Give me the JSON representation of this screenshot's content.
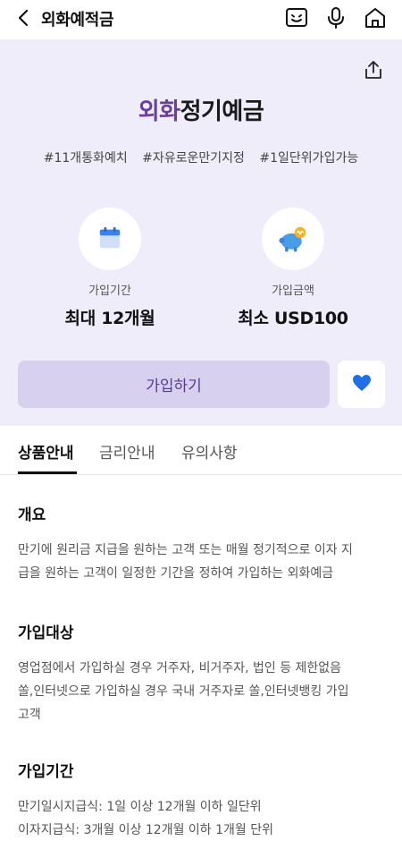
{
  "header": {
    "title": "외화예적금",
    "icons": [
      "chevron-left-icon",
      "chatbot-icon",
      "microphone-icon",
      "home-icon"
    ]
  },
  "hero": {
    "title_accent": "외화",
    "title_rest": "정기예금",
    "tags": [
      "#11개통화예치",
      "#자유로운만기지정",
      "#1일단위가입가능"
    ],
    "period": {
      "label": "가입기간",
      "value": "최대 12개월",
      "icon": "calendar-icon"
    },
    "amount": {
      "label": "가입금액",
      "value": "최소 USD100",
      "icon": "piggy-bank-icon"
    },
    "join_label": "가입하기"
  },
  "tabs": [
    {
      "label": "상품안내",
      "active": true
    },
    {
      "label": "금리안내",
      "active": false
    },
    {
      "label": "유의사항",
      "active": false
    }
  ],
  "sections": {
    "overview": {
      "title": "개요",
      "lines": [
        "만기에 원리금 지급을 원하는 고객 또는 매월 정기적으로 이자 지",
        "급을 원하는 고객이 일정한 기간을 정하여 가입하는 외화예금"
      ]
    },
    "target": {
      "title": "가입대상",
      "lines": [
        "영업점에서 가입하실 경우 거주자, 비거주자, 법인 등 제한없음",
        "쏠,인터넷으로 가입하실 경우 국내 거주자로 쏠,인터넷뱅킹 가입",
        "고객"
      ]
    },
    "term": {
      "title": "가입기간",
      "lines": [
        "만기일시지급식: 1일 이상 12개월 이하 일단위",
        "이자지급식: 3개월 이상 12개월 이하 1개월 단위"
      ]
    }
  },
  "colors": {
    "accent": "#6b3fa0",
    "hero_bg": "#efedf9",
    "join_bg": "#d7d0ee",
    "heart": "#1f6fe5"
  }
}
